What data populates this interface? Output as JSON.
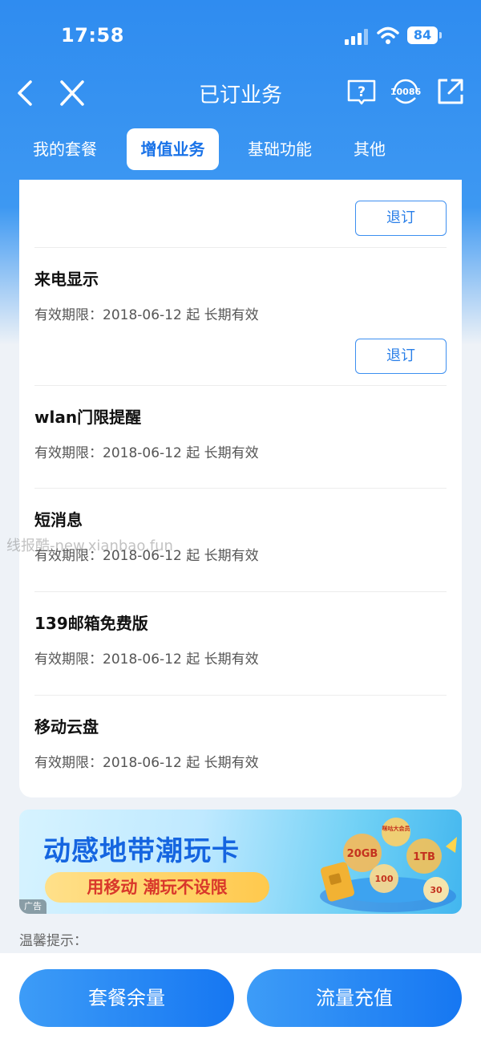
{
  "status": {
    "time": "17:58",
    "battery": "84"
  },
  "nav": {
    "title": "已订业务",
    "service_number": "10086"
  },
  "tabs": [
    {
      "label": "我的套餐",
      "active": false
    },
    {
      "label": "增值业务",
      "active": true
    },
    {
      "label": "基础功能",
      "active": false
    },
    {
      "label": "其他",
      "active": false
    }
  ],
  "services": [
    {
      "name": "来电显示",
      "validity": "有效期限：2018-06-12 起 长期有效",
      "unsubscribe": "退订"
    },
    {
      "name": "wlan门限提醒",
      "validity": "有效期限：2018-06-12 起 长期有效"
    },
    {
      "name": "短消息",
      "validity": "有效期限：2018-06-12 起 长期有效"
    },
    {
      "name": "139邮箱免费版",
      "validity": "有效期限：2018-06-12 起 长期有效"
    },
    {
      "name": "移动云盘",
      "validity": "有效期限：2018-06-12 起 长期有效"
    }
  ],
  "top_unsubscribe": "退订",
  "watermark": "线报酷-new.xianbao.fun",
  "banner": {
    "title": "动感地带潮玩卡",
    "slogan": "用移动 潮玩不设限",
    "ad_tag": "广告",
    "art_labels": [
      "咪咕大会员",
      "20GB",
      "1TB",
      "100",
      "30"
    ]
  },
  "tips_title": "温馨提示：",
  "bottom": {
    "left_button": "套餐余量",
    "right_button": "流量充值"
  },
  "colors": {
    "primary": "#2f8cf0",
    "button_blue": "#1677f2",
    "banner_red": "#d9382b"
  }
}
